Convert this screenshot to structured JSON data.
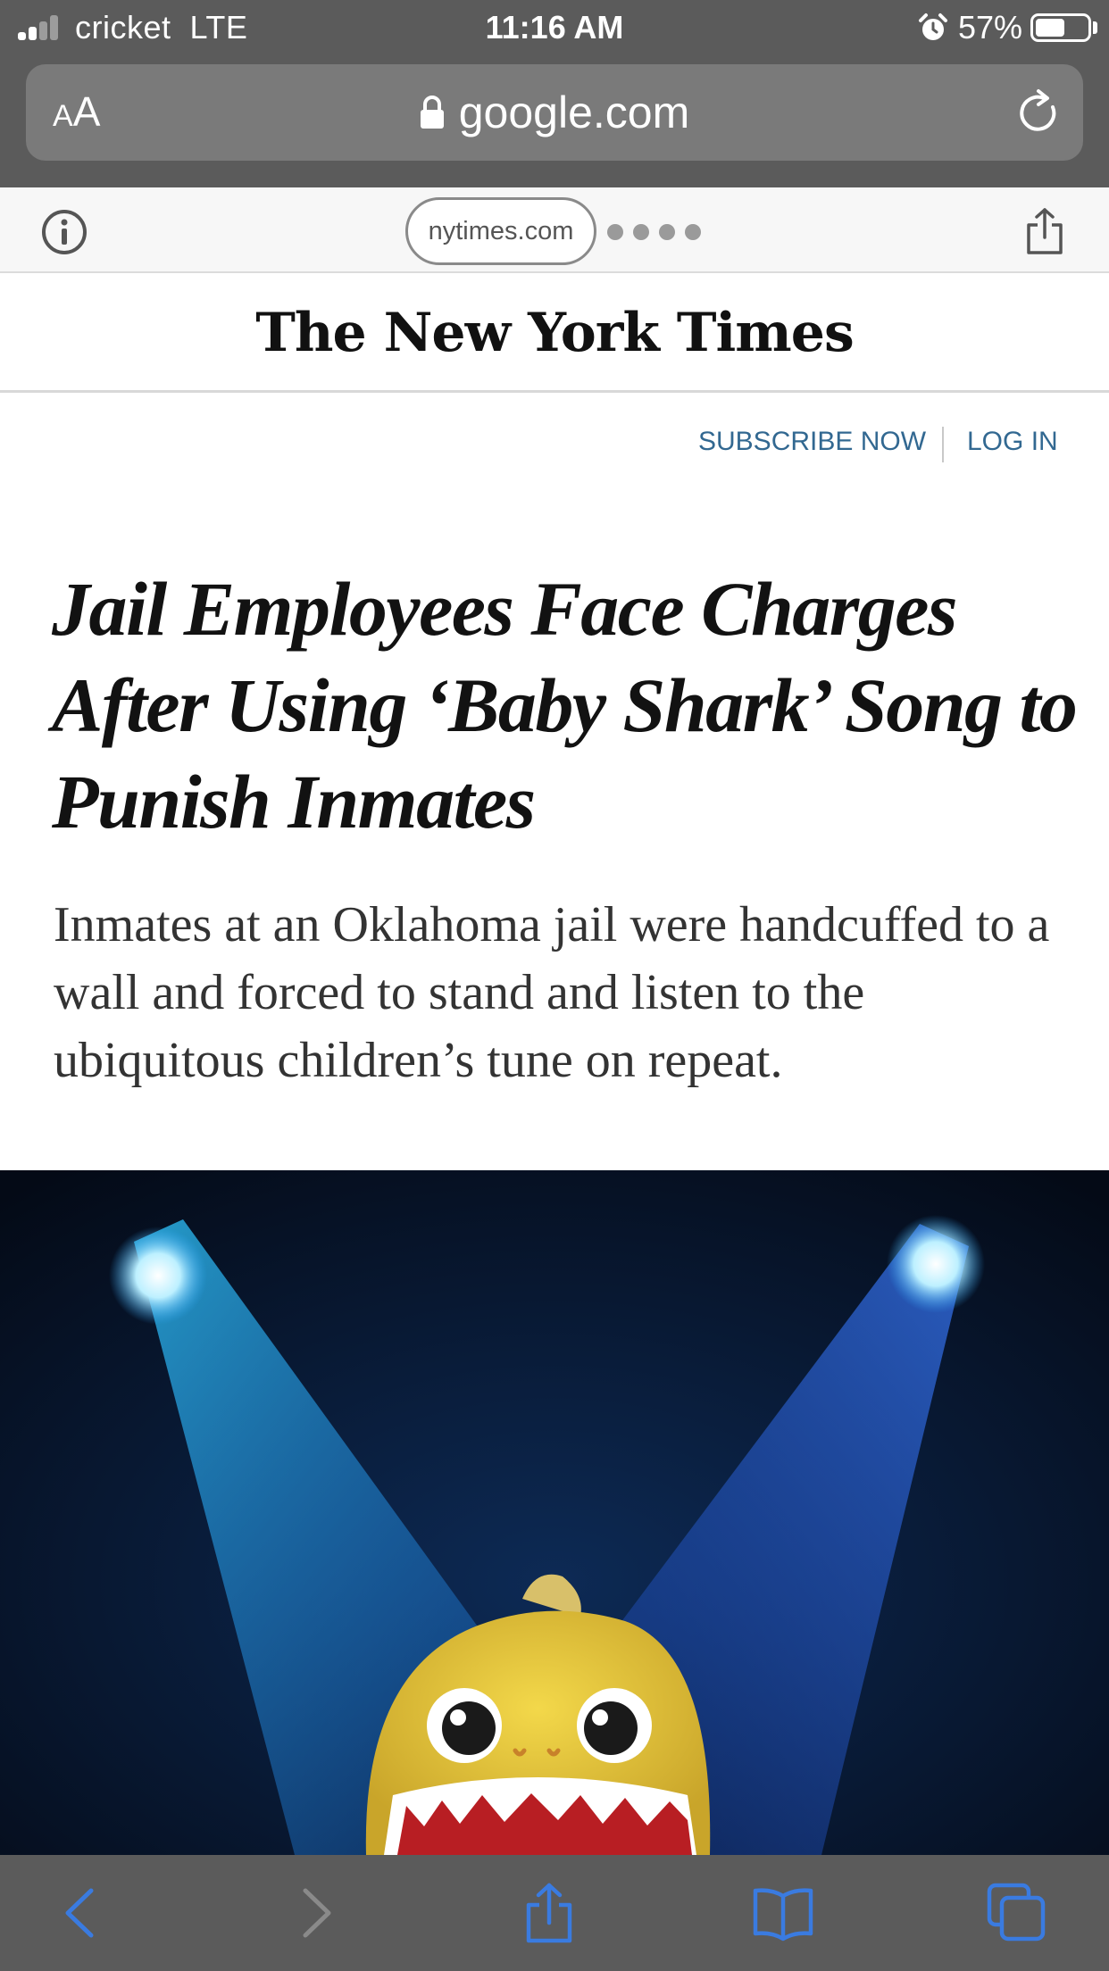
{
  "status_bar": {
    "carrier": "cricket",
    "network": "LTE",
    "time": "11:16 AM",
    "battery_percent": "57%",
    "battery_level": 0.57,
    "signal_bars": 2,
    "icons": [
      "signal-icon",
      "alarm-icon",
      "battery-icon"
    ]
  },
  "browser": {
    "text_size_label": "AA",
    "url": "google.com",
    "icons": [
      "lock-icon",
      "reload-icon"
    ]
  },
  "amp_viewer": {
    "domain": "nytimes.com",
    "icons": [
      "info-icon",
      "share-icon"
    ]
  },
  "masthead": {
    "logo_text": "The New York Times"
  },
  "nav": {
    "subscribe_label": "SUBSCRIBE NOW",
    "login_label": "LOG IN"
  },
  "article": {
    "headline": "Jail Employees Face Charges After Using ‘Baby Shark’ Song to Punish Inmates",
    "summary": "Inmates at an Oklahoma jail were handcuffed to a wall and forced to stand and listen to the ubiquitous children’s tune on repeat."
  },
  "toolbar": {
    "icons": [
      "back-icon",
      "forward-icon",
      "share-icon",
      "bookmarks-icon",
      "tabs-icon"
    ]
  },
  "colors": {
    "chrome": "#5b5b5b",
    "url_bar": "#7a7a7a",
    "link_blue": "#326891",
    "toolbar_blue": "#3a7be0",
    "toolbar_disabled": "#8a8a8a",
    "headline": "#121212"
  }
}
